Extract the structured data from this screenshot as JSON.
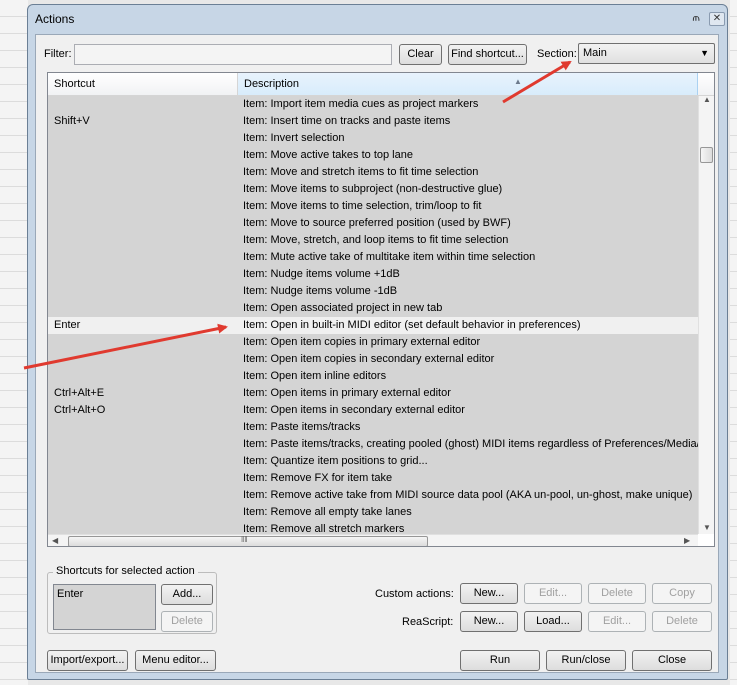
{
  "window": {
    "title": "Actions",
    "pin_glyph": "⫙",
    "close_glyph": "✕"
  },
  "filter": {
    "label": "Filter:",
    "value": "",
    "placeholder": ""
  },
  "toolbar": {
    "clear_label": "Clear",
    "find_shortcut_label": "Find shortcut...",
    "section_label": "Section:",
    "section_value": "Main"
  },
  "list": {
    "columns": [
      "Shortcut",
      "Description"
    ],
    "rows": [
      {
        "shortcut": "",
        "description": "Item: Import item media cues as project markers"
      },
      {
        "shortcut": "Shift+V",
        "description": "Item: Insert time on tracks and paste items"
      },
      {
        "shortcut": "",
        "description": "Item: Invert selection"
      },
      {
        "shortcut": "",
        "description": "Item: Move active takes to top lane"
      },
      {
        "shortcut": "",
        "description": "Item: Move and stretch items to fit time selection"
      },
      {
        "shortcut": "",
        "description": "Item: Move items to subproject (non-destructive glue)"
      },
      {
        "shortcut": "",
        "description": "Item: Move items to time selection, trim/loop to fit"
      },
      {
        "shortcut": "",
        "description": "Item: Move to source preferred position (used by BWF)"
      },
      {
        "shortcut": "",
        "description": "Item: Move, stretch, and loop items to fit time selection"
      },
      {
        "shortcut": "",
        "description": "Item: Mute active take of multitake item within time selection"
      },
      {
        "shortcut": "",
        "description": "Item: Nudge items volume +1dB"
      },
      {
        "shortcut": "",
        "description": "Item: Nudge items volume -1dB"
      },
      {
        "shortcut": "",
        "description": "Item: Open associated project in new tab"
      },
      {
        "shortcut": "Enter",
        "description": "Item: Open in built-in MIDI editor (set default behavior in preferences)",
        "selected": true
      },
      {
        "shortcut": "",
        "description": "Item: Open item copies in primary external editor"
      },
      {
        "shortcut": "",
        "description": "Item: Open item copies in secondary external editor"
      },
      {
        "shortcut": "",
        "description": "Item: Open item inline editors"
      },
      {
        "shortcut": "Ctrl+Alt+E",
        "description": "Item: Open items in primary external editor"
      },
      {
        "shortcut": "Ctrl+Alt+O",
        "description": "Item: Open items in secondary external editor"
      },
      {
        "shortcut": "",
        "description": "Item: Paste items/tracks"
      },
      {
        "shortcut": "",
        "description": "Item: Paste items/tracks, creating pooled (ghost) MIDI items regardless of Preferences/Media/MI"
      },
      {
        "shortcut": "",
        "description": "Item: Quantize item positions to grid..."
      },
      {
        "shortcut": "",
        "description": "Item: Remove FX for item take"
      },
      {
        "shortcut": "",
        "description": "Item: Remove active take from MIDI source data pool (AKA un-pool, un-ghost, make unique)"
      },
      {
        "shortcut": "",
        "description": "Item: Remove all empty take lanes"
      },
      {
        "shortcut": "",
        "description": "Item: Remove all stretch markers"
      }
    ]
  },
  "shortcuts_group": {
    "title": "Shortcuts for selected action",
    "items": [
      "Enter"
    ],
    "add_label": "Add...",
    "delete_label": "Delete"
  },
  "custom_actions": {
    "label": "Custom actions:",
    "new_label": "New...",
    "edit_label": "Edit...",
    "delete_label": "Delete",
    "copy_label": "Copy"
  },
  "reascript": {
    "label": "ReaScript:",
    "new_label": "New...",
    "load_label": "Load...",
    "edit_label": "Edit...",
    "delete_label": "Delete"
  },
  "footer": {
    "import_export_label": "Import/export...",
    "menu_editor_label": "Menu editor...",
    "run_label": "Run",
    "run_close_label": "Run/close",
    "close_label": "Close"
  },
  "icons": {
    "hscroll_thumb_grip": "‖‖"
  },
  "colors": {
    "annotation_arrow": "#e03a2f",
    "list_background": "#d4d4d4",
    "selected_row": "#f0f0f0"
  }
}
